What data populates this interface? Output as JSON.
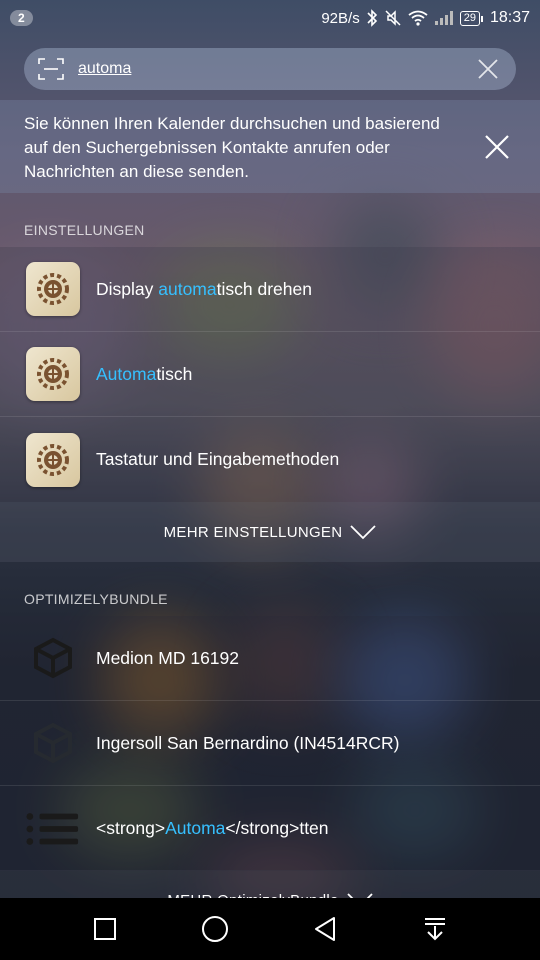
{
  "status_bar": {
    "notification_count": "2",
    "net_speed": "92B/s",
    "battery": "29",
    "time": "18:37"
  },
  "search": {
    "query": "automa"
  },
  "hint": {
    "text": "Sie können Ihren Kalender durchsuchen und basierend auf den Suchergebnissen Kontakte anrufen oder Nachrichten an diese senden."
  },
  "settings_section": {
    "title": "EINSTELLUNGEN",
    "items": [
      {
        "pre": "Display ",
        "match": "automa",
        "post": "tisch drehen",
        "icon": "settings-gear-icon"
      },
      {
        "pre": "",
        "match": "Automa",
        "post": "tisch",
        "icon": "settings-gear-icon"
      },
      {
        "pre": "Tastatur und Eingabemethoden",
        "match": "",
        "post": "",
        "icon": "settings-gear-icon"
      }
    ],
    "more_label": "MEHR EINSTELLUNGEN"
  },
  "bundle_section": {
    "title": "OPTIMIZELYBUNDLE",
    "items": [
      {
        "label": "Medion MD 16192",
        "icon": "cube-icon"
      },
      {
        "label": "Ingersoll San Bernardino (IN4514RCR)",
        "icon": "cube-icon"
      },
      {
        "pre": "<strong>",
        "match": "Automa",
        "post": "</strong>tten",
        "icon": "list-icon"
      }
    ],
    "more_label": "MEHR OptimizelyBundle"
  },
  "colors": {
    "highlight": "#36c0ff",
    "navbar": "#000000"
  }
}
